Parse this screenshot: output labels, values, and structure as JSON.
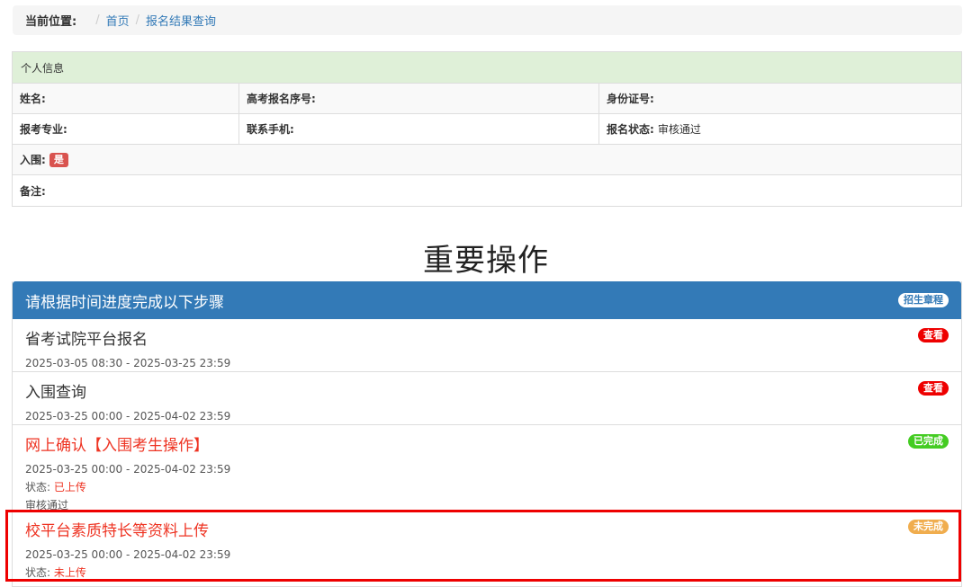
{
  "breadcrumb": {
    "label": "当前位置:",
    "items": [
      "首页",
      "报名结果查询"
    ]
  },
  "info": {
    "header": "个人信息",
    "name_label": "姓名:",
    "exam_no_label": "高考报名序号:",
    "id_label": "身份证号:",
    "major_label": "报考专业:",
    "phone_label": "联系手机:",
    "status_label": "报名状态:",
    "status_value": "审核通过",
    "shortlisted_label": "入围:",
    "shortlisted_value": "是",
    "remark_label": "备注:"
  },
  "title": "重要操作",
  "panel": {
    "heading": "请根据时间进度完成以下步骤",
    "charter_btn": "招生章程",
    "steps": [
      {
        "name": "省考试院平台报名",
        "time": "2025-03-05 08:30 - 2025-03-25 23:59",
        "action": "查看"
      },
      {
        "name": "入围查询",
        "time": "2025-03-25 00:00 - 2025-04-02 23:59",
        "action": "查看"
      },
      {
        "name": "网上确认【入围考生操作】",
        "time": "2025-03-25 00:00 - 2025-04-02 23:59",
        "status_label": "状态:",
        "status_value": "已上传",
        "note": "审核通过",
        "action": "已完成"
      },
      {
        "name": "校平台素质特长等资料上传",
        "time": "2025-03-25 00:00 - 2025-04-02 23:59",
        "status_label": "状态:",
        "status_value": "未上传",
        "action": "未完成"
      }
    ]
  }
}
